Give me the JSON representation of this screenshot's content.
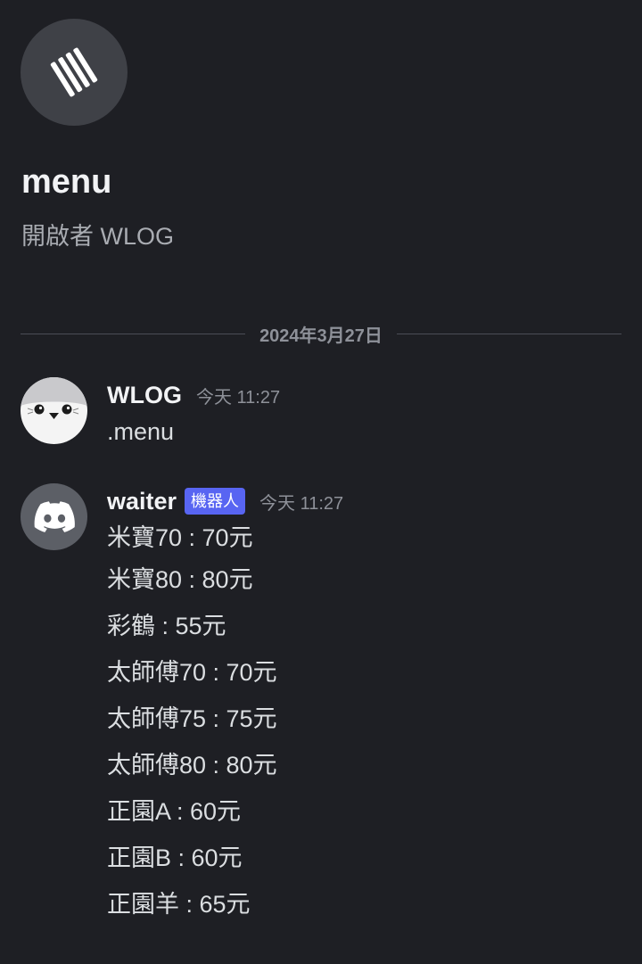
{
  "channel": {
    "icon": "threads-icon",
    "name": "menu",
    "opener": "開啟者 WLOG"
  },
  "divider": {
    "date": "2024年3月27日"
  },
  "messages": [
    {
      "author": "WLOG",
      "avatar": "seal-avatar",
      "timestamp": "今天 11:27",
      "lines": [
        ".menu"
      ]
    },
    {
      "author": "waiter",
      "avatar": "discord-logo-avatar",
      "bot_tag": "機器人",
      "timestamp": "今天 11:27",
      "lines": [
        "米寶70 : 70元",
        "米寶80 : 80元",
        "彩鶴 : 55元",
        "太師傅70 : 70元",
        "太師傅75 : 75元",
        "太師傅80 : 80元",
        "正園A : 60元",
        "正園B : 60元",
        "正園羊 : 65元"
      ]
    }
  ],
  "colors": {
    "background": "#1e1f24",
    "bot_tag": "#5865f2",
    "discord_avatar": "#5c5f66"
  }
}
